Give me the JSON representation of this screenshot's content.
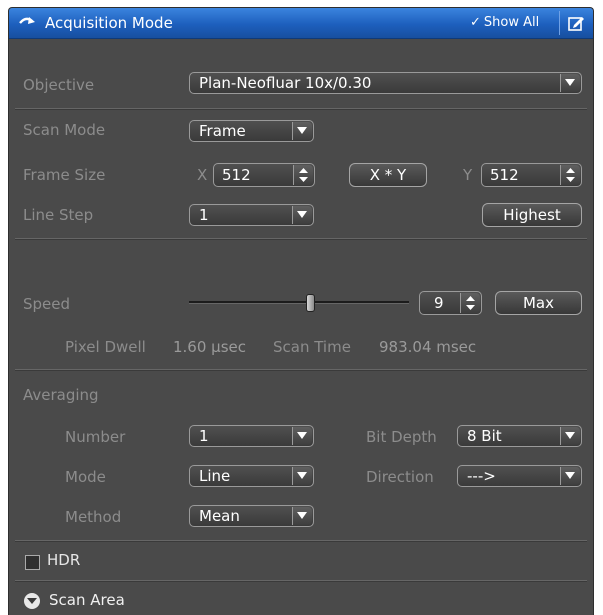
{
  "header": {
    "title": "Acquisition Mode",
    "show_all_label": "Show All",
    "show_all_check": "✓",
    "expand_icon": "collapse-arrow-icon",
    "edit_icon": "edit-icon"
  },
  "objective": {
    "label": "Objective",
    "value": "Plan-Neofluar 10x/0.30"
  },
  "scan_mode": {
    "label": "Scan Mode",
    "value": "Frame"
  },
  "frame_size": {
    "label": "Frame Size",
    "x_label": "X",
    "x_value": "512",
    "xy_button": "X * Y",
    "y_label": "Y",
    "y_value": "512"
  },
  "line_step": {
    "label": "Line Step",
    "value": "1",
    "highest_button": "Highest"
  },
  "speed": {
    "label": "Speed",
    "value": "9",
    "max_button": "Max",
    "slider_level": 9,
    "slider_max": 16
  },
  "timing": {
    "pixel_dwell_label": "Pixel Dwell",
    "pixel_dwell_value": "1.60 µsec",
    "scan_time_label": "Scan Time",
    "scan_time_value": "983.04 msec"
  },
  "averaging": {
    "label": "Averaging",
    "number_label": "Number",
    "number_value": "1",
    "bit_depth_label": "Bit Depth",
    "bit_depth_value": "8 Bit",
    "mode_label": "Mode",
    "mode_value": "Line",
    "direction_label": "Direction",
    "direction_value": "--->",
    "method_label": "Method",
    "method_value": "Mean"
  },
  "hdr": {
    "label": "HDR",
    "checked": false
  },
  "scan_area": {
    "label": "Scan Area"
  }
}
